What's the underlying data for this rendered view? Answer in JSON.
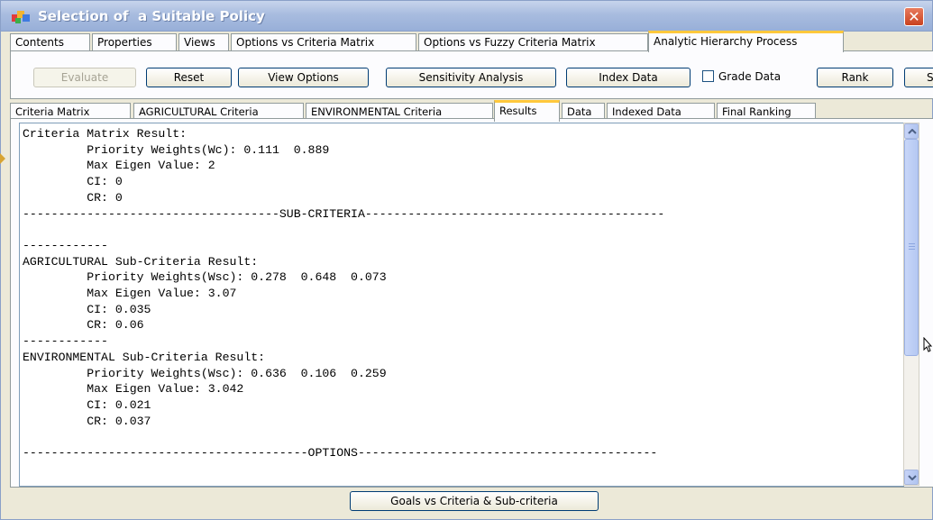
{
  "window": {
    "title": "Selection of  a Suitable Policy",
    "close_glyph": "✕"
  },
  "main_tabs": [
    {
      "label": "Contents",
      "active": false
    },
    {
      "label": "Properties",
      "active": false
    },
    {
      "label": "Views",
      "active": false
    },
    {
      "label": "Options vs Criteria Matrix",
      "active": false
    },
    {
      "label": "Options vs Fuzzy Criteria Matrix",
      "active": false
    },
    {
      "label": "Analytic Hierarchy Process",
      "active": true
    }
  ],
  "toolbar": {
    "evaluate": "Evaluate",
    "reset": "Reset",
    "view_options": "View Options",
    "sensitivity": "Sensitivity Analysis",
    "index_data": "Index Data",
    "grade_data": "Grade Data",
    "grade_data_checked": false,
    "rank": "Rank",
    "cut_button": "S"
  },
  "sub_tabs": [
    {
      "label": "Criteria Matrix",
      "active": false
    },
    {
      "label": "AGRICULTURAL Criteria",
      "active": false
    },
    {
      "label": "ENVIRONMENTAL Criteria",
      "active": false
    },
    {
      "label": "Results",
      "active": true
    },
    {
      "label": "Data",
      "active": false
    },
    {
      "label": "Indexed Data",
      "active": false
    },
    {
      "label": "Final Ranking",
      "active": false
    }
  ],
  "results_text": "Criteria Matrix Result:\n         Priority Weights(Wc): 0.111  0.889\n         Max Eigen Value: 2\n         CI: 0\n         CR: 0\n------------------------------------SUB-CRITERIA------------------------------------------\n\n------------\nAGRICULTURAL Sub-Criteria Result:\n         Priority Weights(Wsc): 0.278  0.648  0.073\n         Max Eigen Value: 3.07\n         CI: 0.035\n         CR: 0.06\n------------\nENVIRONMENTAL Sub-Criteria Result:\n         Priority Weights(Wsc): 0.636  0.106  0.259\n         Max Eigen Value: 3.042\n         CI: 0.021\n         CR: 0.037\n\n----------------------------------------OPTIONS------------------------------------------",
  "bottom": {
    "goals_button": "Goals vs Criteria & Sub-criteria"
  }
}
